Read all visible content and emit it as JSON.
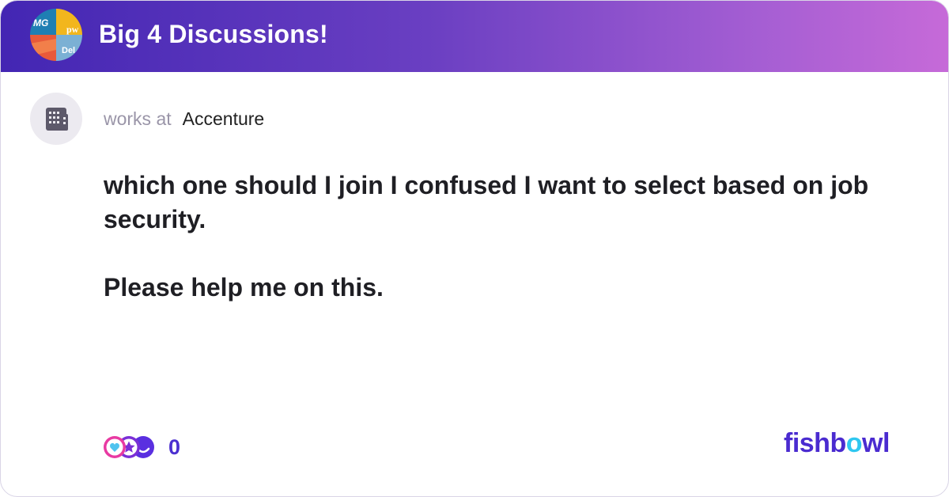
{
  "header": {
    "title": "Big 4 Discussions!",
    "avatar_texts": [
      "MG",
      "pw",
      "Del"
    ],
    "gradient_start": "#4326b3",
    "gradient_end": "#c66ad8"
  },
  "post": {
    "works_label": "works at",
    "company": "Accenture",
    "company_icon": "building-icon",
    "body_line1": "which one should I join I confused I want to select based on job security.",
    "body_line2": "Please help me on this."
  },
  "footer": {
    "reaction_count": "0",
    "reaction_icons": [
      "heart-icon",
      "star-icon",
      "smile-icon"
    ],
    "brand_parts": [
      "fishb",
      "o",
      "wl"
    ],
    "brand_color": "#4a2bd0",
    "brand_accent": "#2fc7f0"
  }
}
